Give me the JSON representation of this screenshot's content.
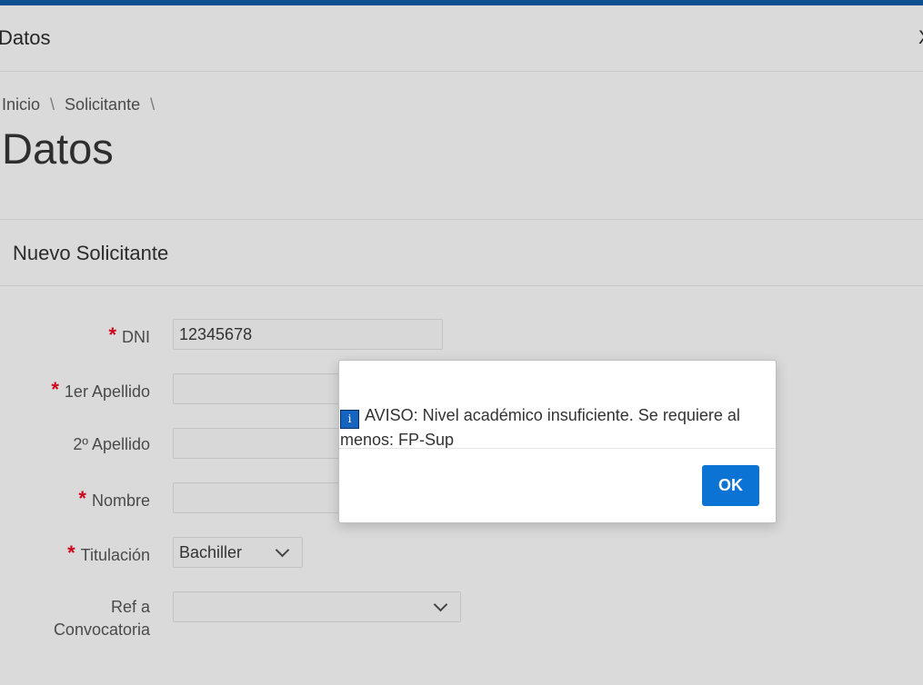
{
  "dialog": {
    "title": "Datos",
    "close_glyph": "X"
  },
  "breadcrumb": {
    "items": [
      "Inicio",
      "Solicitante"
    ],
    "separator": "\\"
  },
  "page": {
    "title": "Datos"
  },
  "region": {
    "title": "Nuevo Solicitante"
  },
  "form": {
    "required_mark": "*",
    "dni": {
      "label": "DNI",
      "value": "12345678"
    },
    "apellido1": {
      "label": "1er Apellido",
      "value": ""
    },
    "apellido2": {
      "label": "2º Apellido",
      "value": ""
    },
    "nombre": {
      "label": "Nombre",
      "value": ""
    },
    "titulacion": {
      "label": "Titulación",
      "value": "Bachiller"
    },
    "convocatoria": {
      "label_line1": "Ref a",
      "label_line2": "Convocatoria",
      "value": ""
    }
  },
  "alert": {
    "icon": "info-icon",
    "icon_glyph": "i",
    "message": "AVISO: Nivel académico insuficiente. Se requiere al menos: FP-Sup",
    "ok_label": "OK"
  },
  "colors": {
    "topbar": "#0d4f8f",
    "primary_button": "#0a73d3",
    "required": "#d0021b",
    "overlay_bg": "#dadada"
  }
}
